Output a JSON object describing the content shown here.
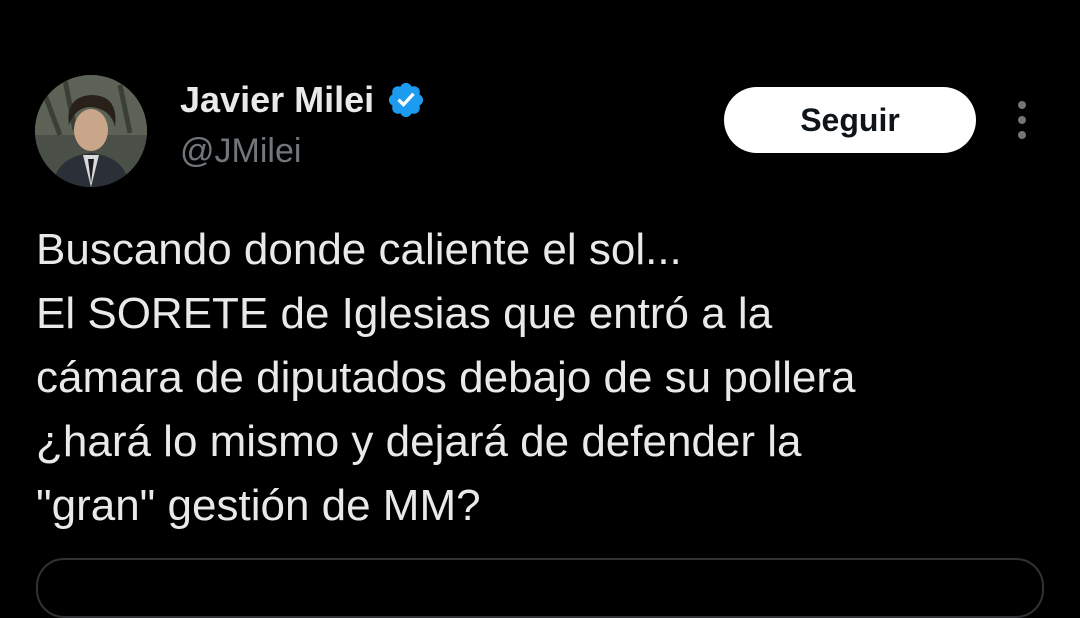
{
  "user": {
    "display_name": "Javier Milei",
    "handle": "@JMilei",
    "verified": true,
    "verified_color": "#1d9bf0"
  },
  "actions": {
    "follow_label": "Seguir",
    "more_icon": "more-vertical-icon"
  },
  "tweet": {
    "lines": [
      "Buscando donde caliente el sol...",
      "El SORETE de Iglesias que entró a la",
      "cámara de diputados debajo de su pollera",
      "¿hará lo mismo y dejará de defender la",
      "\"gran\" gestión de MM?"
    ]
  },
  "colors": {
    "background": "#000000",
    "text": "#e7e9ea",
    "secondary_text": "#71767b",
    "button_bg": "#ffffff",
    "button_text": "#0f1419",
    "border": "#2f3336"
  }
}
